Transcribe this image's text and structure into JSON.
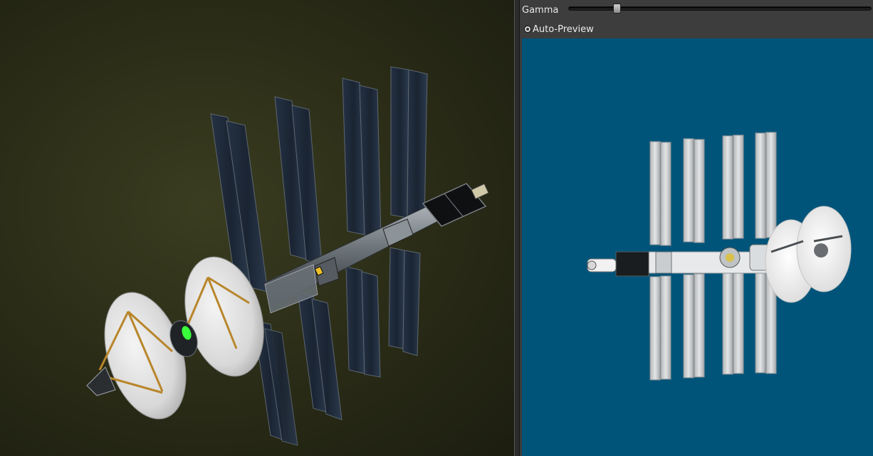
{
  "viewport": {
    "background": "#2c2e18",
    "subject": "spacecraft-model"
  },
  "panel": {
    "gamma": {
      "label": "Gamma",
      "value": 0.15
    },
    "auto_preview": {
      "label": "Auto-Preview",
      "checked": true
    },
    "preview": {
      "background": "#00547a"
    }
  },
  "colors": {
    "solar_panel": "#1c2735",
    "truss": "#8f9aa0",
    "strut": "#b8862b",
    "accent_green": "#39ff3a",
    "panel_bg": "#3d3d3d"
  }
}
